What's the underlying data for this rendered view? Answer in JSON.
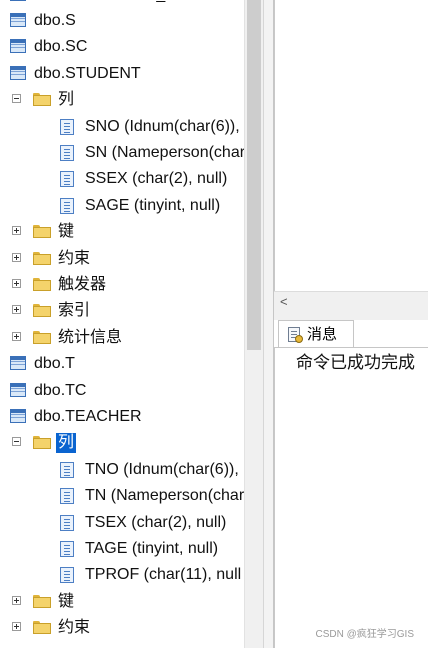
{
  "tree": {
    "partial_top": "dbo.SMATRIBUT_S",
    "nodes": [
      {
        "kind": "table",
        "label": "dbo.S"
      },
      {
        "kind": "table",
        "label": "dbo.SC"
      },
      {
        "kind": "table",
        "label": "dbo.STUDENT"
      },
      {
        "kind": "folder",
        "label": "列",
        "expander": "minus"
      },
      {
        "kind": "column",
        "label": "SNO (Idnum(char(6)),"
      },
      {
        "kind": "column",
        "label": "SN (Nameperson(char"
      },
      {
        "kind": "column",
        "label": "SSEX (char(2), null)"
      },
      {
        "kind": "column",
        "label": "SAGE (tinyint, null)"
      },
      {
        "kind": "folder",
        "label": "键",
        "expander": "plus"
      },
      {
        "kind": "folder",
        "label": "约束",
        "expander": "plus"
      },
      {
        "kind": "folder",
        "label": "触发器",
        "expander": "plus"
      },
      {
        "kind": "folder",
        "label": "索引",
        "expander": "plus"
      },
      {
        "kind": "folder",
        "label": "统计信息",
        "expander": "plus"
      },
      {
        "kind": "table",
        "label": "dbo.T"
      },
      {
        "kind": "table",
        "label": "dbo.TC"
      },
      {
        "kind": "table",
        "label": "dbo.TEACHER"
      },
      {
        "kind": "folder",
        "label": "列",
        "expander": "minus",
        "selected": true
      },
      {
        "kind": "column",
        "label": "TNO (Idnum(char(6)),"
      },
      {
        "kind": "column",
        "label": "TN (Nameperson(char"
      },
      {
        "kind": "column",
        "label": "TSEX (char(2), null)"
      },
      {
        "kind": "column",
        "label": "TAGE (tinyint, null)"
      },
      {
        "kind": "column",
        "label": "TPROF (char(11), null"
      },
      {
        "kind": "folder",
        "label": "键",
        "expander": "plus"
      },
      {
        "kind": "folder",
        "label": "约束",
        "expander": "plus"
      }
    ]
  },
  "results": {
    "scroll_left_glyph": "<",
    "messages_tab_label": "消息",
    "message_text": "命令已成功完成"
  },
  "watermark": "CSDN @疯狂学习GIS",
  "colors": {
    "selection": "#0a64d0",
    "table_icon": "#3a70b8",
    "folder": "#f4d36b"
  }
}
